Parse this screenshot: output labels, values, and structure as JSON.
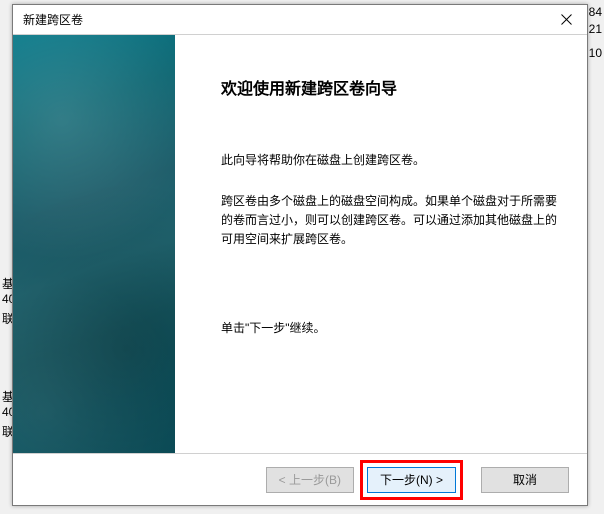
{
  "background": {
    "left1": "基",
    "left2": "40",
    "left3": "联",
    "left4": "基",
    "left5": "40",
    "left6": "联",
    "right1": "84",
    "right2": "21",
    "right3": "10"
  },
  "dialog": {
    "title": "新建跨区卷",
    "heading": "欢迎使用新建跨区卷向导",
    "para1": "此向导将帮助你在磁盘上创建跨区卷。",
    "para2": "跨区卷由多个磁盘上的磁盘空间构成。如果单个磁盘对于所需要的卷而言过小，则可以创建跨区卷。可以通过添加其他磁盘上的可用空间来扩展跨区卷。",
    "para3": "单击\"下一步\"继续。",
    "buttons": {
      "back": "< 上一步(B)",
      "next": "下一步(N) >",
      "cancel": "取消"
    }
  }
}
